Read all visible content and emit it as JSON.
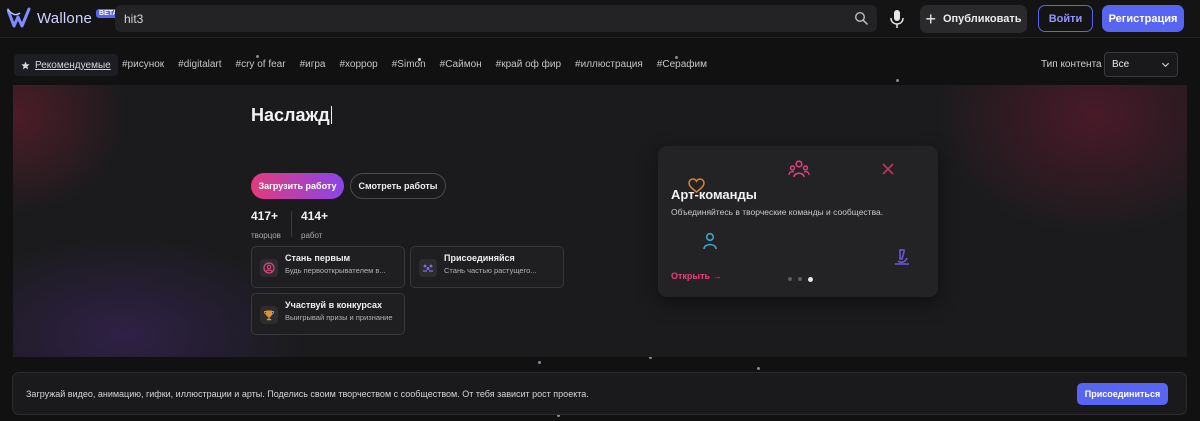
{
  "header": {
    "logo_text": "Wallone",
    "beta_badge": "BETA",
    "search_value": "hit3",
    "publish_label": "Опубликовать",
    "login_label": "Войти",
    "register_label": "Регистрация"
  },
  "tagbar": {
    "featured_label": "Рекомендуемые",
    "tags": [
      "#рисунок",
      "#digitalart",
      "#cry of fear",
      "#игра",
      "#хоррор",
      "#Simon",
      "#Саймон",
      "#край оф фир",
      "#иллюстрация",
      "#Серафим"
    ],
    "content_type_label": "Тип контента",
    "content_type_value": "Все"
  },
  "hero": {
    "title_typed": "Наслажд",
    "upload_label": "Загрузить работу",
    "view_label": "Смотреть работы",
    "stats": [
      {
        "value": "417+",
        "label": "творцов"
      },
      {
        "value": "414+",
        "label": "работ"
      }
    ],
    "features": [
      {
        "title": "Стань первым",
        "subtitle": "Будь первооткрывателем в..."
      },
      {
        "title": "Присоединяйся",
        "subtitle": "Стань частью растущего..."
      },
      {
        "title": "Участвуй в конкурсах",
        "subtitle": "Выигрывай призы и признание"
      }
    ],
    "card": {
      "title": "Арт-команды",
      "subtitle": "Объединяйтесь в творческие команды и сообщества.",
      "open_label": "Открыть →",
      "slide_count": 3,
      "active_slide": 3
    }
  },
  "banner": {
    "text": "Загружай видео, анимацию, гифки, иллюстрации и арты. Поделись своим творчеством с сообществом. От тебя зависит рост проекта.",
    "button_label": "Присоединиться"
  },
  "colors": {
    "accent": "#5865f2",
    "pink": "#ec3d79",
    "gradient_start": "#e23b7d",
    "gradient_end": "#8a45e8"
  }
}
